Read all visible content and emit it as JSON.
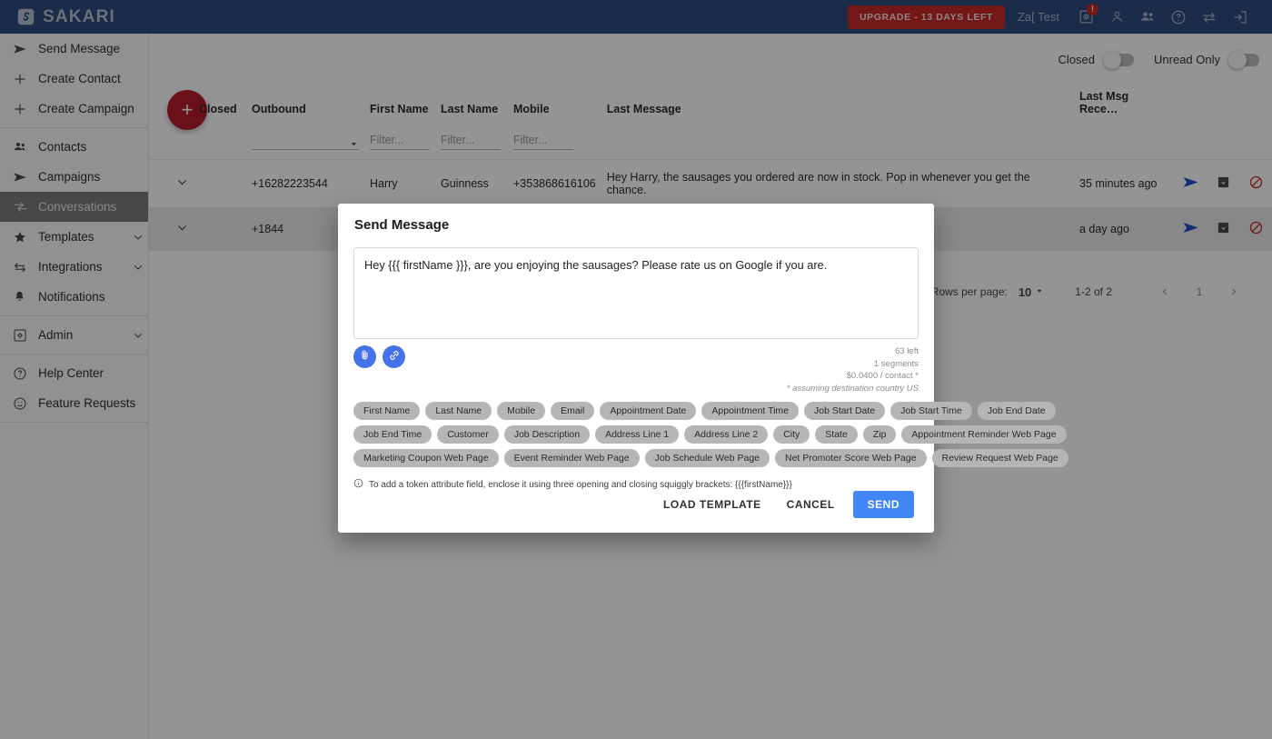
{
  "brand": {
    "name": "SAKARI",
    "logo_icon": "sakari-logo-icon",
    "bar_color": "#2d4c80"
  },
  "topbar": {
    "upgrade_label": "UPGRADE - 13 DAYS LEFT",
    "upgrade_color": "#c62828",
    "account_name": "Za[ Test",
    "settings_badge": "!",
    "icons": [
      {
        "name": "settings-gear-icon"
      },
      {
        "name": "user-icon"
      },
      {
        "name": "people-icon"
      },
      {
        "name": "help-circle-icon"
      },
      {
        "name": "switch-account-icon"
      },
      {
        "name": "logout-icon"
      }
    ]
  },
  "sidebar": {
    "items": [
      {
        "label": "Send Message",
        "icon": "paper-plane-icon",
        "active": false,
        "chevron": false
      },
      {
        "label": "Create Contact",
        "icon": "plus-icon",
        "active": false,
        "chevron": false
      },
      {
        "label": "Create Campaign",
        "icon": "plus-icon",
        "active": false,
        "chevron": false
      },
      {
        "label": "Contacts",
        "icon": "people-icon",
        "active": false,
        "chevron": false
      },
      {
        "label": "Campaigns",
        "icon": "paper-plane-icon",
        "active": false,
        "chevron": false
      },
      {
        "label": "Conversations",
        "icon": "conversations-icon",
        "active": true,
        "chevron": false
      },
      {
        "label": "Templates",
        "icon": "star-icon",
        "active": false,
        "chevron": true
      },
      {
        "label": "Integrations",
        "icon": "exchange-icon",
        "active": false,
        "chevron": true
      },
      {
        "label": "Notifications",
        "icon": "bell-icon",
        "active": false,
        "chevron": false
      },
      {
        "label": "Admin",
        "icon": "admin-gear-icon",
        "active": false,
        "chevron": true
      },
      {
        "label": "Help Center",
        "icon": "help-circle-icon",
        "active": false,
        "chevron": false
      },
      {
        "label": "Feature Requests",
        "icon": "smiley-icon",
        "active": false,
        "chevron": false
      }
    ]
  },
  "main": {
    "toggles": [
      {
        "label": "Closed",
        "on": false
      },
      {
        "label": "Unread Only",
        "on": false
      }
    ],
    "add_button_label": "+",
    "table": {
      "columns": [
        "",
        "Closed",
        "Outbound",
        "First Name",
        "Last Name",
        "Mobile",
        "Last Message",
        "Last Msg Rece…",
        "",
        "",
        ""
      ],
      "filters": {
        "outbound_placeholder": "",
        "first_name_placeholder": "Filter...",
        "last_name_placeholder": "Filter...",
        "mobile_placeholder": "Filter..."
      },
      "rows": [
        {
          "closed": "",
          "outbound": "+16282223544",
          "first_name": "Harry",
          "last_name": "Guinness",
          "mobile": "+353868616106",
          "last_message": "Hey Harry, the sausages you ordered are now in stock. Pop in whenever you get the chance.",
          "received": "35 minutes ago",
          "selected": false
        },
        {
          "closed": "",
          "outbound": "+1844",
          "first_name": "",
          "last_name": "",
          "mobile": "",
          "last_message": "",
          "received": "a day ago",
          "selected": true
        }
      ],
      "row_actions": [
        "send-icon",
        "archive-icon",
        "block-icon"
      ]
    },
    "paginator": {
      "rows_per_page_label": "Rows per page:",
      "rows_per_page_value": "10",
      "range": "1-2 of 2",
      "prev": "‹",
      "page": "1",
      "next": "›"
    }
  },
  "modal": {
    "title": "Send Message",
    "message_value": "Hey {{{ firstName }}}, are you enjoying the sausages? Please rate us on Google if you are.",
    "message_placeholder": "",
    "attach_icon": "paperclip-icon",
    "link_icon": "link-icon",
    "counts": {
      "chars_left": "63 left",
      "segments": "1 segments",
      "price": "$0.0400 / contact *",
      "note": "* assuming destination country US"
    },
    "token_rows": [
      [
        "First Name",
        "Last Name",
        "Mobile",
        "Email",
        "Appointment Date",
        "Appointment Time",
        "Job Start Date",
        "Job Start Time",
        "Job End Date"
      ],
      [
        "Job End Time",
        "Customer",
        "Job Description",
        "Address Line 1",
        "Address Line 2",
        "City",
        "State",
        "Zip",
        "Appointment Reminder Web Page"
      ],
      [
        "Marketing Coupon Web Page",
        "Event Reminder Web Page",
        "Job Schedule Web Page",
        "Net Promoter Score Web Page",
        "Review Request Web Page"
      ]
    ],
    "hint": "To add a token attribute field, enclose it using three opening and closing squiggly brackets: {{{firstName}}}",
    "hint_icon": "info-icon",
    "load_template_label": "LOAD TEMPLATE",
    "cancel_label": "CANCEL",
    "send_label": "SEND",
    "send_color": "#4285f4"
  }
}
